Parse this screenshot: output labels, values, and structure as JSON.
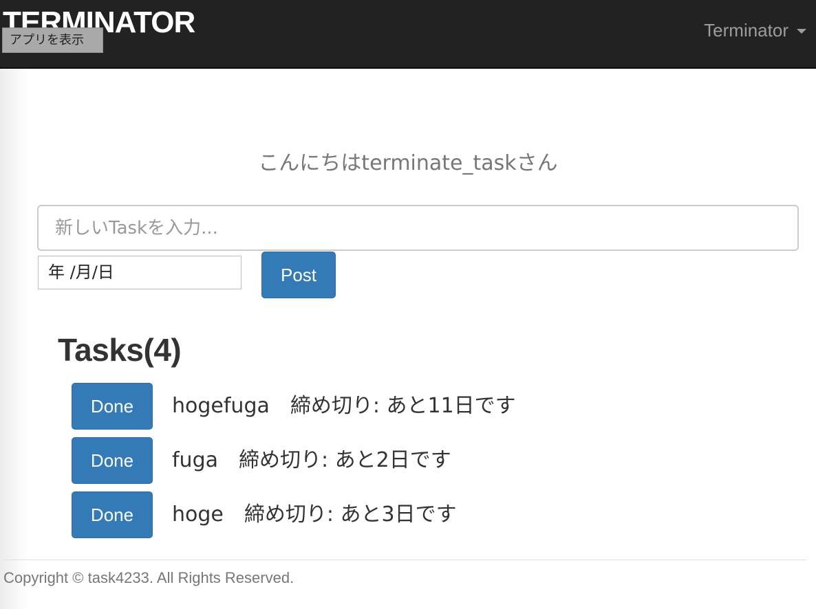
{
  "navbar": {
    "brand": "TERMINATOR",
    "show_app_button": "アプリを表示",
    "user_menu_label": "Terminator"
  },
  "greeting": "こんにちはterminate_taskさん",
  "new_task": {
    "placeholder": "新しいTaskを入力...",
    "date_placeholder": "年 /月/日",
    "post_label": "Post"
  },
  "tasks": {
    "heading": "Tasks(4)",
    "items": [
      {
        "done_label": "Done",
        "text": "hogefuga　締め切り: あと11日です"
      },
      {
        "done_label": "Done",
        "text": "fuga　締め切り: あと2日です"
      },
      {
        "done_label": "Done",
        "text": "hoge　締め切り: あと3日です"
      }
    ]
  },
  "footer": {
    "copyright": "Copyright © task4233. All Rights Reserved."
  },
  "colors": {
    "navbar_bg": "#222222",
    "primary_button": "#337ab7",
    "muted_text": "#777777"
  }
}
